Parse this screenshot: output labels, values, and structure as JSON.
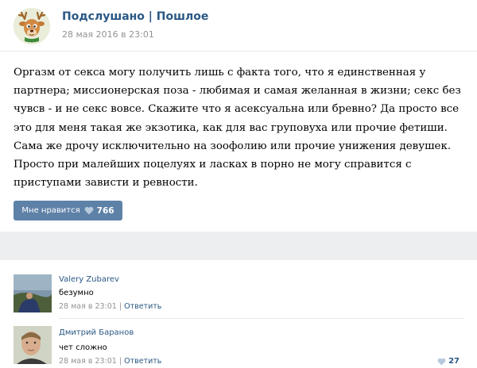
{
  "post": {
    "author": "Подслушано | Пошлое",
    "date": "28 мая 2016 в 23:01",
    "text": "Оргазм от секса могу получить лишь с факта того, что я единственная у партнера; миссионерская поза - любимая и самая желанная в жизни; секс без чувсв - и не секс вовсе. Скажите что я асексуальна или бревно? Да просто все это для меня такая же экзотика, как для вас груповуха или прочие фетиши. Сама же дрочу исключительно на зоофолию или прочие унижения девушек. Просто при малейших поцелуях и ласках в порно не могу справится с приступами зависти и ревности.",
    "like_label": "Мне нравится",
    "like_count": "766"
  },
  "comments": [
    {
      "name": "Valery Zubarev",
      "text": "безумно",
      "date": "28 мая в 23:01",
      "sep": "|",
      "reply": "Ответить",
      "likes": ""
    },
    {
      "name": "Дмитрий Баранов",
      "text": "чет сложно",
      "date": "28 мая в 23:01",
      "sep": "|",
      "reply": "Ответить",
      "likes": "27"
    }
  ],
  "colors": {
    "link": "#2a5885",
    "button": "#5e81a8",
    "band": "#edeef0",
    "muted": "#939393"
  }
}
